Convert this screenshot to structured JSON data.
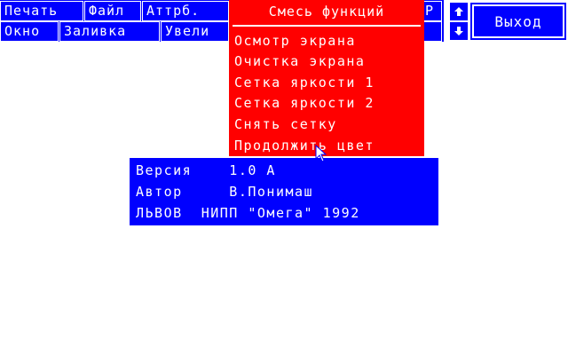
{
  "menubar": {
    "row1": [
      "Печать",
      "Файл",
      "Аттрб.",
      "Р"
    ],
    "row2": [
      "Окно",
      "Заливка",
      "Увели"
    ]
  },
  "scroll": {
    "up_icon": "arrow-up-icon",
    "down_icon": "arrow-down-icon"
  },
  "exit_label": "Выход",
  "dropdown": {
    "title": "Смесь функций",
    "items": [
      "Осмотр экрана",
      "Очистка экрана",
      "Сетка яркости 1",
      "Сетка яркости 2",
      "Снять сетку",
      "Продолжить цвет"
    ]
  },
  "info": {
    "version": "Версия    1.0 A",
    "author": "Автор     В.Понимаш",
    "org": "ЛЬВОВ  НИПП \"Омега\" 1992"
  },
  "colors": {
    "menu": "#0000ff",
    "dropdown": "#ff0000",
    "text": "#ffffff",
    "background": "#ffffff"
  }
}
